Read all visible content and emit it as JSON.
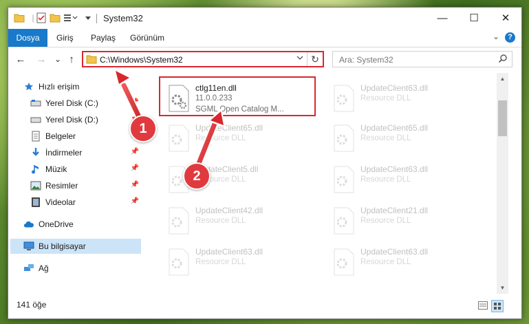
{
  "window": {
    "title": "System32",
    "controls": {
      "minimize": "—",
      "maximize": "☐",
      "close": "✕"
    }
  },
  "ribbon": {
    "tabs": [
      {
        "label": "Dosya",
        "active": true
      },
      {
        "label": "Giriş"
      },
      {
        "label": "Paylaş"
      },
      {
        "label": "Görünüm"
      }
    ],
    "help": "?"
  },
  "nav": {
    "back": "←",
    "forward": "→",
    "recent": "⌄",
    "up": "↑",
    "address": "C:\\Windows\\System32",
    "refresh": "↻",
    "search_placeholder": "Ara: System32"
  },
  "sidebar": {
    "items": [
      {
        "label": "Hızlı erişim",
        "icon": "star-icon"
      },
      {
        "label": "Yerel Disk (C:)",
        "icon": "drive-icon",
        "pinned": true
      },
      {
        "label": "Yerel Disk (D:)",
        "icon": "drive-icon",
        "pinned": true
      },
      {
        "label": "Belgeler",
        "icon": "documents-icon",
        "pinned": true
      },
      {
        "label": "İndirmeler",
        "icon": "download-icon",
        "pinned": true
      },
      {
        "label": "Müzik",
        "icon": "music-icon",
        "pinned": true
      },
      {
        "label": "Resimler",
        "icon": "pictures-icon",
        "pinned": true
      },
      {
        "label": "Videolar",
        "icon": "videos-icon",
        "pinned": true
      },
      {
        "label": "OneDrive",
        "icon": "cloud-icon"
      },
      {
        "label": "Bu bilgisayar",
        "icon": "computer-icon",
        "selected": true
      },
      {
        "label": "Ağ",
        "icon": "network-icon"
      }
    ]
  },
  "files": [
    {
      "name": "ctlg11en.dll",
      "line2": "11.0.0.233",
      "line3": "SGML Open Catalog M...",
      "highlighted": true
    },
    {
      "name": "UpdateClient63.dll",
      "line2": "Resource DLL"
    },
    {
      "name": "UpdateClient65.dll",
      "line2": "Resource DLL"
    },
    {
      "name": "UpdateClient65.dll",
      "line2": "Resource DLL"
    },
    {
      "name": "UpdateClient5.dll",
      "line2": "Resource DLL"
    },
    {
      "name": "UpdateClient63.dll",
      "line2": "Resource DLL"
    },
    {
      "name": "UpdateClient42.dll",
      "line2": "Resource DLL"
    },
    {
      "name": "UpdateClient21.dll",
      "line2": "Resource DLL"
    },
    {
      "name": "UpdateClient63.dll",
      "line2": "Resource DLL"
    },
    {
      "name": "UpdateClient63.dll",
      "line2": "Resource DLL"
    }
  ],
  "status": {
    "count": "141 öğe"
  },
  "annotations": {
    "one": "1",
    "two": "2",
    "accent": "#e03a3e"
  },
  "colors": {
    "accent": "#1979ca",
    "selected": "#cce4f7",
    "highlight": "#d9272e"
  }
}
